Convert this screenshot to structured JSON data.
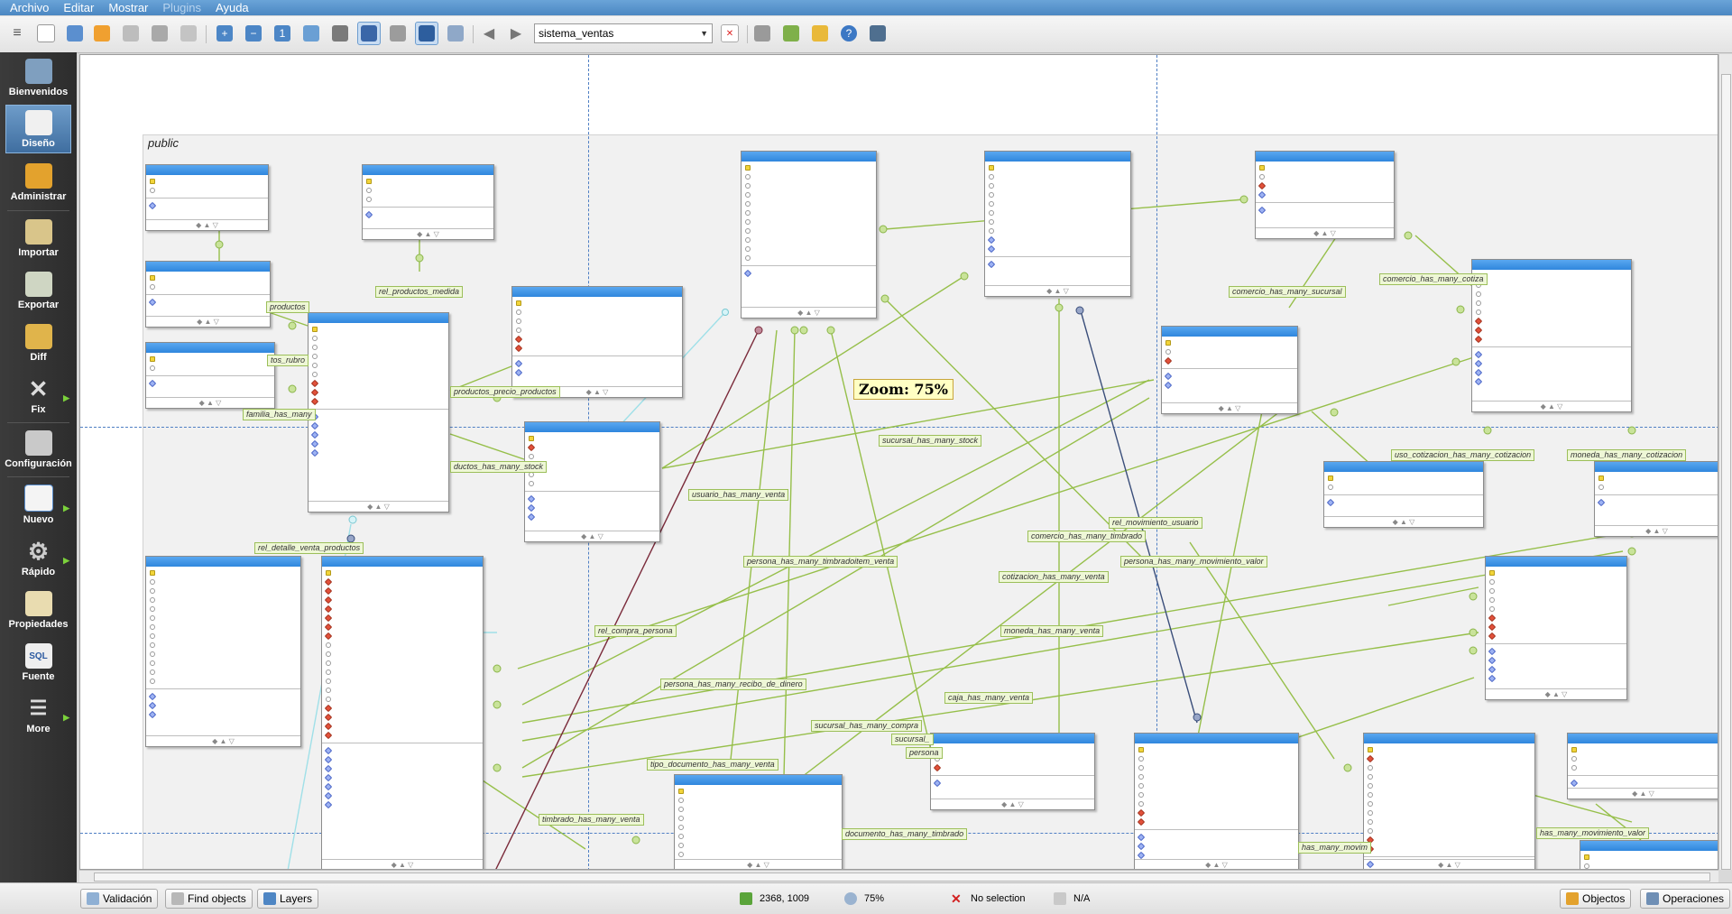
{
  "menubar": {
    "items": [
      "Archivo",
      "Editar",
      "Mostrar",
      "Plugins",
      "Ayuda"
    ]
  },
  "toolbar": {
    "model_select": "sistema_ventas",
    "icons": [
      "menu-icon",
      "new-model-icon",
      "open-icon",
      "recent-icon",
      "save-icon",
      "save-as-icon",
      "export-icon",
      "zoom-in-icon",
      "zoom-out-icon",
      "zoom-reset-icon",
      "adjust-zoom-icon",
      "list-icon",
      "grid-icon",
      "grid-options-icon",
      "align-icon",
      "objects-grid-icon",
      "back-arrow-icon",
      "forward-arrow-icon",
      "close-model-icon",
      "plugin-icon",
      "database-icon",
      "objects-icon",
      "help-icon",
      "update-icon"
    ]
  },
  "sidebar": {
    "items": [
      {
        "label": "Bienvenidos",
        "icon": "welcome-icon"
      },
      {
        "label": "Diseño",
        "icon": "design-icon"
      },
      {
        "label": "Administrar",
        "icon": "manage-icon"
      },
      {
        "label": "Importar",
        "icon": "import-icon"
      },
      {
        "label": "Exportar",
        "icon": "export-icon"
      },
      {
        "label": "Diff",
        "icon": "diff-icon"
      },
      {
        "label": "Fix",
        "icon": "wrench-icon"
      },
      {
        "label": "Configuración",
        "icon": "settings-icon"
      },
      {
        "label": "Nuevo",
        "icon": "new-icon"
      },
      {
        "label": "Rápido",
        "icon": "quick-gear-icon"
      },
      {
        "label": "Propiedades",
        "icon": "properties-icon"
      },
      {
        "label": "Fuente",
        "icon": "sql-source-icon"
      },
      {
        "label": "More",
        "icon": "more-icon"
      }
    ]
  },
  "canvas": {
    "schema": "public",
    "zoom_tip": "Zoom: 75%",
    "relationships": [
      "rel_productos_medida",
      "productos",
      "tos_rubro",
      "familia_has_many",
      "productos_precio_productos",
      "ductos_has_many_stock",
      "rel_detalle_venta_productos",
      "sucursal_has_many_stock",
      "usuario_has_many_venta",
      "persona_has_many_timbradoitem_venta",
      "rel_compra_persona",
      "persona_has_many_recibo_de_dinero",
      "tipo_documento_has_many_venta",
      "timbrado_has_many_venta",
      "sucursal_has_many_compra",
      "sucursal_",
      "persona",
      "caja_has_many_venta",
      "moneda_has_many_venta",
      "cotizacion_has_many_venta",
      "comercio_has_many_timbrado",
      "rel_movimiento_usuario",
      "persona_has_many_movimiento_valor",
      "comercio_has_many_sucursal",
      "comercio_has_many_cotiza",
      "uso_cotizacion_has_many_cotizacion",
      "moneda_has_many_cotizacion",
      "documento_has_many_timbrado",
      "has_many_movimiento_valor",
      "has_many_movim"
    ]
  },
  "statusbar": {
    "validation": "Validación",
    "find_objects": "Find objects",
    "layers": "Layers",
    "coords": "2368, 1009",
    "zoom": "75%",
    "selection": "No selection",
    "na": "N/A",
    "objects": "Objectos",
    "operations": "Operaciones"
  }
}
